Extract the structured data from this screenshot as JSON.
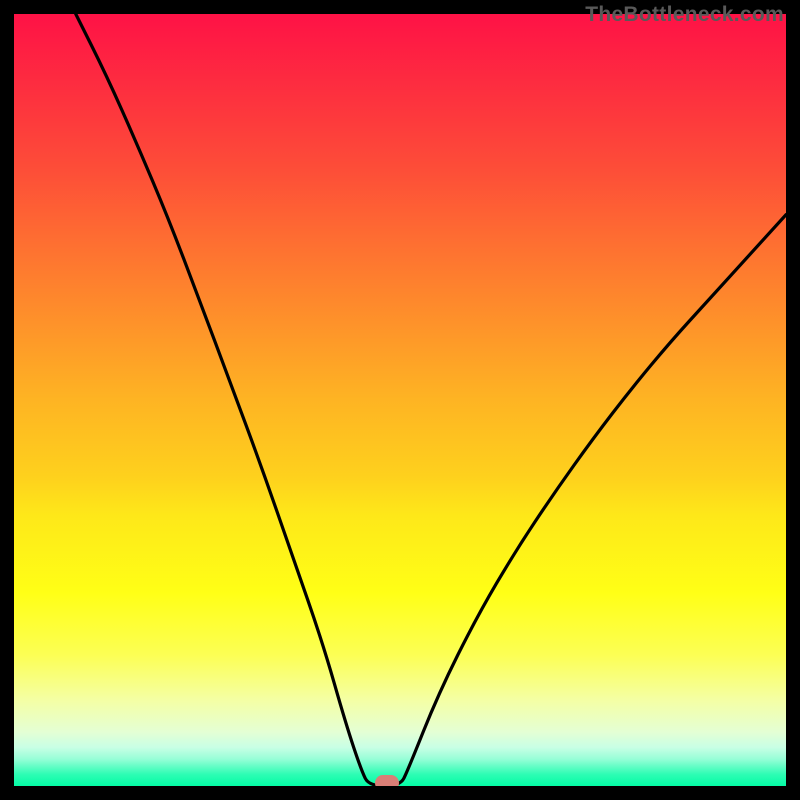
{
  "watermark": "TheBottleneck.com",
  "chart_data": {
    "type": "line",
    "title": "",
    "xlabel": "",
    "ylabel": "",
    "xlim": [
      0,
      100
    ],
    "ylim": [
      0,
      100
    ],
    "background_gradient": {
      "top": "#fe1246",
      "bottom": "#04fca5",
      "description": "vertical red→orange→yellow→green gradient indicating bottleneck severity (top=high, bottom=low)"
    },
    "curve_description": "Two steep branches meeting near the bottom, left branch starting at upper-left, right branch rising to the right edge, minimum around x≈48 near y≈0",
    "curve_points": [
      {
        "x": 8.0,
        "y": 100.0
      },
      {
        "x": 12.0,
        "y": 92.0
      },
      {
        "x": 16.0,
        "y": 83.0
      },
      {
        "x": 20.0,
        "y": 73.5
      },
      {
        "x": 24.0,
        "y": 63.0
      },
      {
        "x": 28.0,
        "y": 52.3
      },
      {
        "x": 32.0,
        "y": 41.5
      },
      {
        "x": 36.0,
        "y": 30.0
      },
      {
        "x": 40.0,
        "y": 18.5
      },
      {
        "x": 43.0,
        "y": 8.0
      },
      {
        "x": 45.0,
        "y": 2.0
      },
      {
        "x": 46.0,
        "y": 0.0
      },
      {
        "x": 50.0,
        "y": 0.0
      },
      {
        "x": 51.0,
        "y": 2.0
      },
      {
        "x": 55.0,
        "y": 12.0
      },
      {
        "x": 60.0,
        "y": 22.0
      },
      {
        "x": 65.0,
        "y": 30.5
      },
      {
        "x": 70.0,
        "y": 38.0
      },
      {
        "x": 75.0,
        "y": 45.0
      },
      {
        "x": 80.0,
        "y": 51.5
      },
      {
        "x": 85.0,
        "y": 57.5
      },
      {
        "x": 90.0,
        "y": 63.0
      },
      {
        "x": 95.0,
        "y": 68.5
      },
      {
        "x": 100.0,
        "y": 74.0
      }
    ],
    "marker": {
      "x": 48.3,
      "y": 0.0,
      "color": "#d97e76",
      "shape": "rounded-rect"
    }
  }
}
